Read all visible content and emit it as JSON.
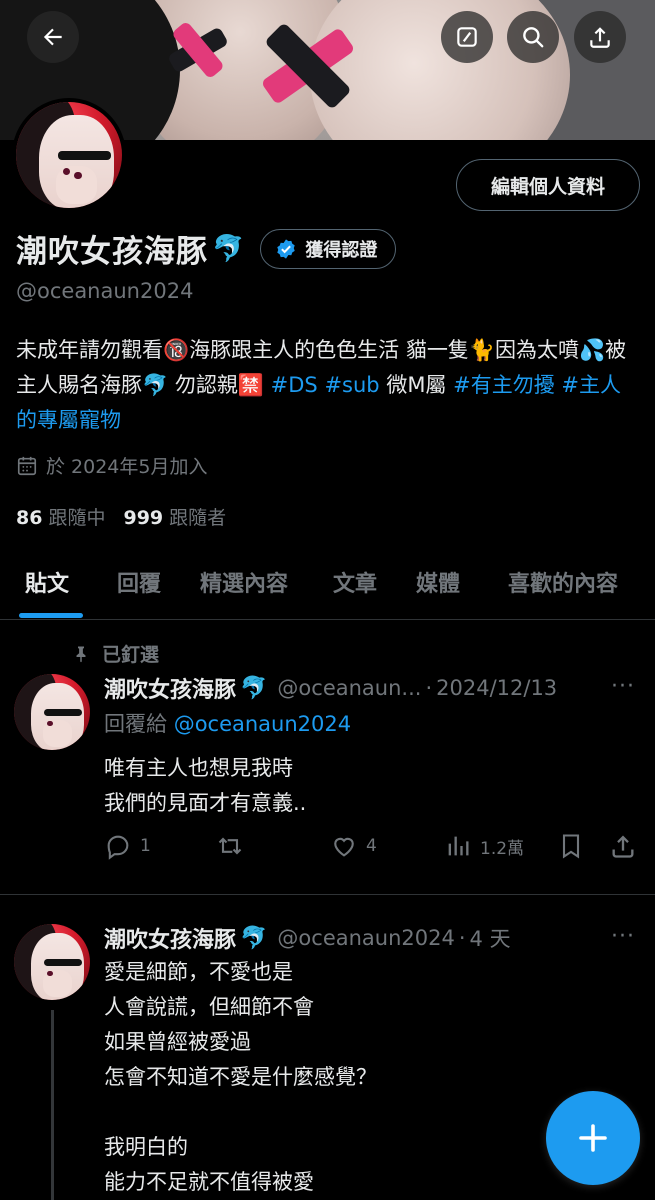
{
  "banner": {
    "alt": ""
  },
  "header_buttons": {
    "back": "back-arrow-icon",
    "edit": "edit-icon",
    "search": "search-icon",
    "share": "share-icon"
  },
  "profile": {
    "edit_label": "編輯個人資料",
    "display_name": "潮吹女孩海豚",
    "name_emoji": "🐬",
    "verify_label": "獲得認證",
    "handle": "@oceanaun2024",
    "bio_parts": [
      "未成年請勿觀看🔞海豚跟主人的色色生活 貓一隻🐈因為太噴💦被主人賜名海豚🐬 勿認親🈲 ",
      "#DS",
      " ",
      "#sub",
      " 微M屬 ",
      "#有主勿擾",
      " ",
      "#主人的專屬寵物"
    ],
    "joined": "於 2024年5月加入",
    "following_count": "86",
    "following_label": "跟隨中",
    "followers_count": "999",
    "followers_label": "跟隨者"
  },
  "tabs": [
    "貼文",
    "回覆",
    "精選內容",
    "文章",
    "媒體",
    "喜歡的內容"
  ],
  "pinned_label": "已釘選",
  "tweets": [
    {
      "name": "潮吹女孩海豚",
      "emoji": "🐬",
      "handle": "@oceanaun...",
      "dot": "·",
      "time": "2024/12/13",
      "more": "···",
      "reply_prefix": "回覆給 ",
      "reply_handle": "@oceanaun2024",
      "text": "唯有主人也想見我時\n我們的見面才有意義..",
      "replies": "1",
      "retweets": "",
      "likes": "4",
      "views": "1.2萬"
    },
    {
      "name": "潮吹女孩海豚",
      "emoji": "🐬",
      "handle": "@oceanaun2024",
      "dot": "·",
      "time": "4 天",
      "more": "···",
      "text": "愛是細節，不愛也是\n人會說謊，但細節不會\n如果曾經被愛過\n怎會不知道不愛是什麼感覺？\n\n我明白的\n能力不足就不值得被愛"
    }
  ],
  "colors": {
    "accent": "#1d9bf0",
    "muted": "#71767b",
    "text": "#e7e9ea",
    "border": "#2f3336"
  }
}
